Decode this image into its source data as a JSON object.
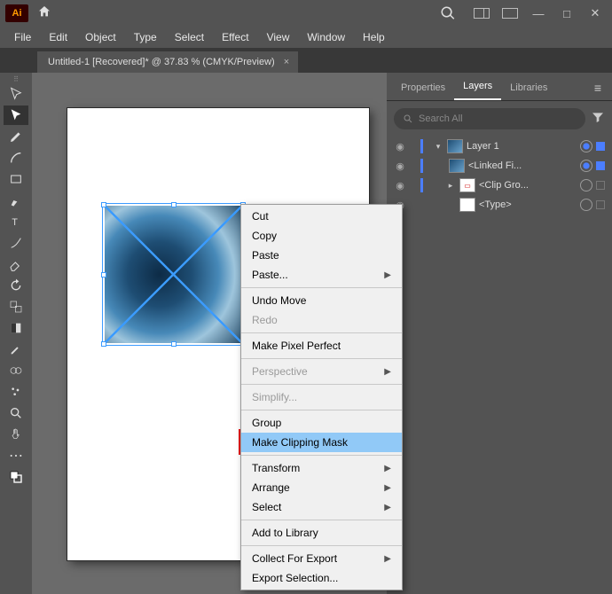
{
  "titlebar": {
    "app_abbrev": "Ai"
  },
  "menubar": {
    "items": [
      "File",
      "Edit",
      "Object",
      "Type",
      "Select",
      "Effect",
      "View",
      "Window",
      "Help"
    ]
  },
  "doctab": {
    "title": "Untitled-1 [Recovered]* @ 37.83 % (CMYK/Preview)",
    "close": "×"
  },
  "tools": [
    "selection",
    "direct-selection",
    "pen",
    "curvature",
    "type",
    "line",
    "rectangle",
    "brush",
    "text",
    "arc",
    "eraser",
    "rotate",
    "scale",
    "gradient",
    "eyedropper",
    "blend",
    "symbol",
    "artboard",
    "zoom",
    "hand",
    "ellipsis",
    "fill-stroke"
  ],
  "panels": {
    "tabs": {
      "properties": "Properties",
      "layers": "Layers",
      "libraries": "Libraries"
    },
    "search_placeholder": "Search All",
    "layers": [
      {
        "name": "Layer 1",
        "depth": 0,
        "thumb": "img",
        "expanded": true,
        "targeted": true,
        "selected": true,
        "visible": true
      },
      {
        "name": "<Linked Fi...",
        "depth": 1,
        "thumb": "img",
        "targeted": true,
        "selected": true,
        "visible": true
      },
      {
        "name": "<Clip Gro...",
        "depth": 1,
        "thumb": "clip",
        "has_children": true,
        "targeted": false,
        "selected": false,
        "visible": true
      },
      {
        "name": "<Type>",
        "depth": 1,
        "thumb": "blank",
        "targeted": false,
        "selected": false,
        "visible": true
      }
    ]
  },
  "context_menu": {
    "items": [
      {
        "label": "Cut"
      },
      {
        "label": "Copy"
      },
      {
        "label": "Paste"
      },
      {
        "label": "Paste...",
        "sub": true
      },
      {
        "sep": true
      },
      {
        "label": "Undo Move"
      },
      {
        "label": "Redo",
        "disabled": true
      },
      {
        "sep": true
      },
      {
        "label": "Make Pixel Perfect"
      },
      {
        "sep": true
      },
      {
        "label": "Perspective",
        "sub": true,
        "disabled": true
      },
      {
        "sep": true
      },
      {
        "label": "Simplify...",
        "disabled": true
      },
      {
        "sep": true
      },
      {
        "label": "Group"
      },
      {
        "label": "Make Clipping Mask",
        "highlight": true
      },
      {
        "sep": true
      },
      {
        "label": "Transform",
        "sub": true
      },
      {
        "label": "Arrange",
        "sub": true
      },
      {
        "label": "Select",
        "sub": true
      },
      {
        "sep": true
      },
      {
        "label": "Add to Library"
      },
      {
        "sep": true
      },
      {
        "label": "Collect For Export",
        "sub": true
      },
      {
        "label": "Export Selection..."
      }
    ]
  }
}
